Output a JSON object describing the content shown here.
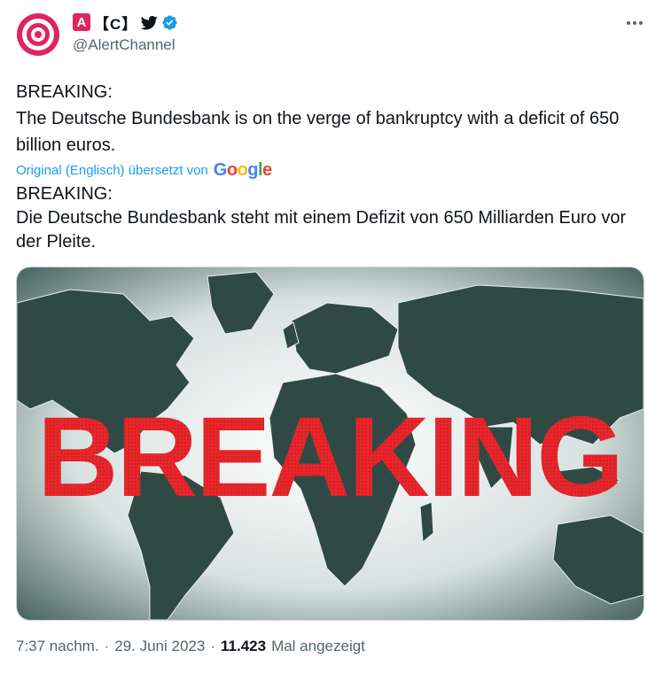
{
  "author": {
    "badge_letter": "A",
    "name_brackets": "【C】",
    "handle": "@AlertChannel",
    "avatar_icon": "target-icon",
    "avatar_color": "#e0245e",
    "verified_color": "#1d9bf0"
  },
  "tweet": {
    "original_title": "BREAKING:",
    "original_body": "The Deutsche Bundesbank is on the verge of bankruptcy with a deficit of 650 billion euros.",
    "translation_note": "Original (Englisch) übersetzt von",
    "translation_provider": "Google",
    "translated_title": "BREAKING:",
    "translated_body": "Die Deutsche Bundesbank steht mit einem Defizit von 650 Milliarden Euro vor der Pleite."
  },
  "media": {
    "overlay_text": "BREAKING",
    "overlay_color": "#e8262b",
    "map_color": "#2f4a45"
  },
  "meta": {
    "time": "7:37 nachm.",
    "separator": "·",
    "date": "29. Juni 2023",
    "views_count": "11.423",
    "views_label": "Mal angezeigt"
  }
}
